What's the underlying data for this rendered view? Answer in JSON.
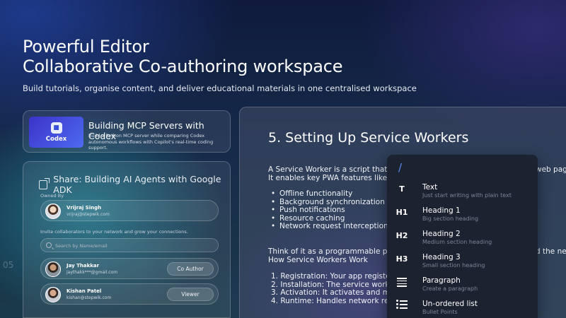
{
  "hero": {
    "title_line1": "Powerful Editor",
    "title_line2": "Collaborative Co-authoring workspace",
    "subtitle": "Build tutorials, organise content, and deliver educational materials in one centralised workspace"
  },
  "course_card": {
    "thumb_caption": "Codex",
    "title": "Building MCP Servers with Codex",
    "description": "Build a Python MCP server while comparing Codex autonomous workflows with Copilot's real-time coding support."
  },
  "share_panel": {
    "title": "Share: Building AI Agents with Google ADK",
    "owned_by_label": "Owned By",
    "owner": {
      "name": "Vrijraj Singh",
      "email": "vrijraj@stepwik.com"
    },
    "invite_text": "Invite collaborators to your network and grow your connections.",
    "search_placeholder": "Search by Name/email",
    "collaborators": [
      {
        "name": "Jay Thakkar",
        "email": "jaythakk***@gmail.com",
        "role": "Co Author"
      },
      {
        "name": "Kishan Patel",
        "email": "kishan@stepwik.com",
        "role": "Viewer"
      }
    ]
  },
  "background_fragment": "05",
  "editor": {
    "heading": "5. Setting Up Service Workers",
    "para1_line1": "A Service Worker is a script that r",
    "para1_line1_right": "web pag",
    "para1_line2": "It enables key PWA features like:",
    "bullets": [
      "Offline functionality",
      "Background synchronization",
      "Push notifications",
      "Resource caching",
      "Network request interception"
    ],
    "para2_line1": "Think of it as a programmable pro",
    "para2_line1_right": "d the ne",
    "para2_line2": "How Service Workers Work",
    "steps": [
      "1. Registration: Your app register",
      "2. Installation: The service worke",
      "3. Activation: It activates and ma",
      "4. Runtime: Handles network req"
    ]
  },
  "slash_menu": {
    "trigger": "/",
    "items": [
      {
        "icon": "T",
        "label": "Text",
        "description": "Just start writing with plain text"
      },
      {
        "icon": "H1",
        "label": "Heading 1",
        "description": "Big section heading"
      },
      {
        "icon": "H2",
        "label": "Heading 2",
        "description": "Medium section heading"
      },
      {
        "icon": "H3",
        "label": "Heading 3",
        "description": "Small section heading"
      },
      {
        "icon": "paragraph-icon",
        "label": "Paragraph",
        "description": "Create a paragraph"
      },
      {
        "icon": "bullet-list-icon",
        "label": "Un-ordered list",
        "description": "Bullet Points"
      }
    ]
  }
}
